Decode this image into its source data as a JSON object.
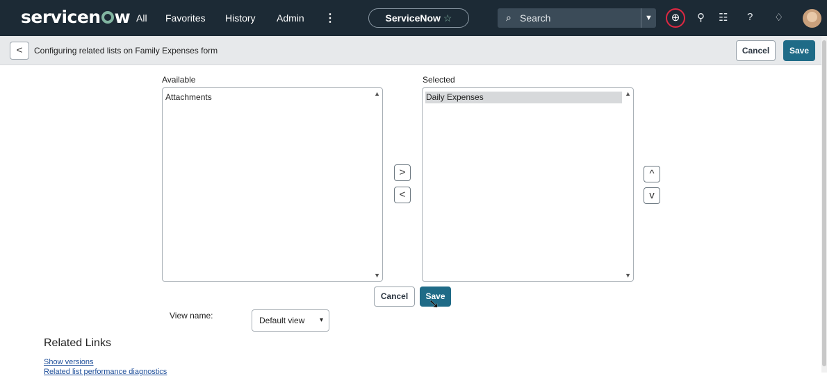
{
  "topnav": {
    "logo": "servicenow",
    "links": [
      "All",
      "Favorites",
      "History",
      "Admin"
    ],
    "more_glyph": "⋮",
    "app_pill": "ServiceNow",
    "search_placeholder": "Search",
    "icons": [
      "search-icon",
      "dropdown-chevron-icon",
      "globe-icon",
      "chat-icon",
      "inbox-icon",
      "help-icon",
      "bell-icon",
      "avatar"
    ]
  },
  "header": {
    "back_glyph": "<",
    "title": "Configuring related lists on Family Expenses form",
    "cancel_label": "Cancel",
    "save_label": "Save"
  },
  "slushbucket": {
    "available_label": "Available",
    "available_items": [
      "Attachments"
    ],
    "selected_label": "Selected",
    "selected_items": [
      "Daily Expenses"
    ],
    "add_glyph": ">",
    "remove_glyph": "<",
    "up_glyph": "^",
    "down_glyph": "v",
    "cancel_label": "Cancel",
    "save_label": "Save"
  },
  "view": {
    "label": "View name:",
    "value": "Default view"
  },
  "related_links": {
    "title": "Related Links",
    "items": [
      "Show versions",
      "Related list performance diagnostics"
    ]
  },
  "colors": {
    "nav_bg": "#1c2a35",
    "accent": "#1f6b87",
    "logo_accent": "#81b5a1",
    "highlight_ring": "#e02842"
  }
}
